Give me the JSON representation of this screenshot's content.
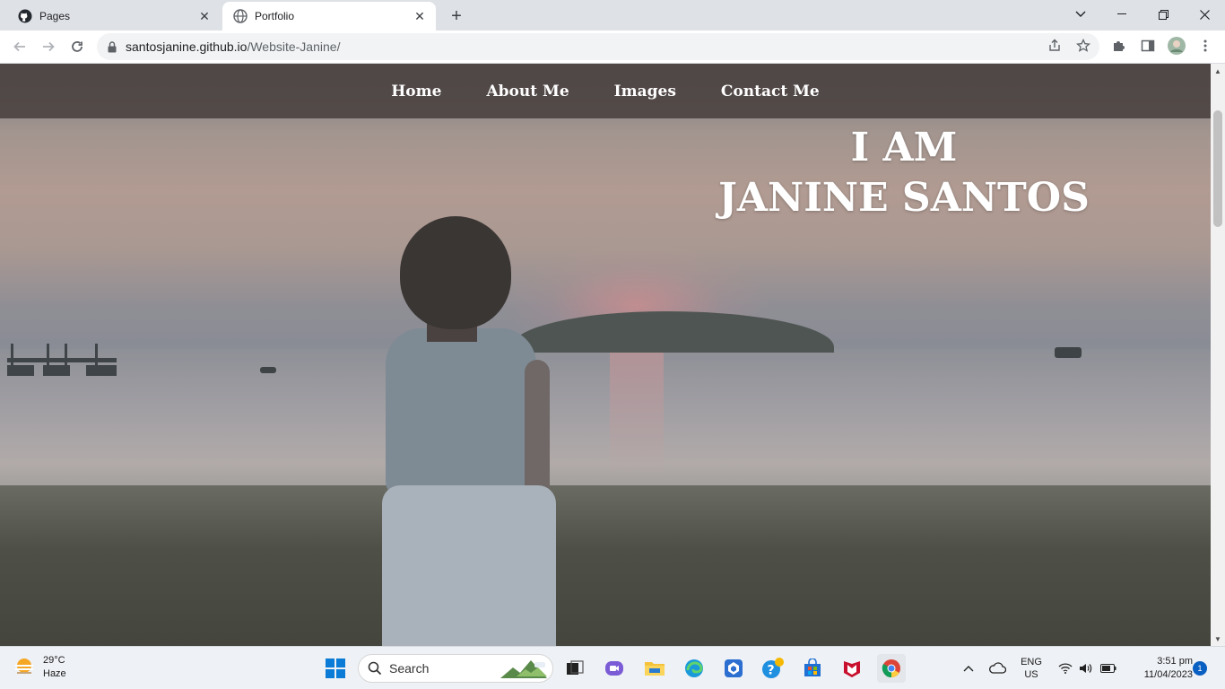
{
  "browser": {
    "tabs": [
      {
        "title": "Pages",
        "favicon": "github-icon",
        "active": false
      },
      {
        "title": "Portfolio",
        "favicon": "globe-icon",
        "active": true
      }
    ],
    "url_host": "santosjanine.github.io",
    "url_path": "/Website-Janine/"
  },
  "page": {
    "nav": [
      "Home",
      "About Me",
      "Images",
      "Contact Me"
    ],
    "hero_line1": "I AM",
    "hero_line2": "JANINE SANTOS"
  },
  "taskbar": {
    "weather_temp": "29°C",
    "weather_desc": "Haze",
    "search_label": "Search",
    "language_line1": "ENG",
    "language_line2": "US",
    "time": "3:51 pm",
    "date": "11/04/2023",
    "notification_count": "1"
  },
  "colors": {
    "nav_bar": "#463e3c",
    "browser_tabstrip": "#dee1e6",
    "taskbar": "#eef1f5"
  }
}
